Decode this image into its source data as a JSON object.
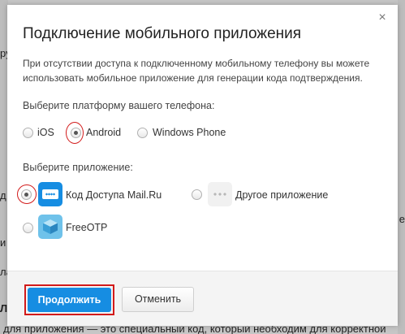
{
  "background": {
    "bottom_text": "для приложения — это специальный код, который необходим для корректной",
    "left_fragments": [
      "ру",
      "д",
      "и",
      "ла",
      "Л"
    ],
    "right_fragments": [
      "е"
    ]
  },
  "dialog": {
    "close_glyph": "×",
    "title": "Подключение мобильного приложения",
    "description": "При отсутствии доступа к подключенному мобильному телефону вы можете использовать мобильное приложение для генерации кода подтверждения.",
    "platform_label": "Выберите платформу вашего телефона:",
    "platforms": [
      {
        "label": "iOS",
        "checked": false
      },
      {
        "label": "Android",
        "checked": true
      },
      {
        "label": "Windows Phone",
        "checked": false
      }
    ],
    "app_label": "Выберите приложение:",
    "apps": [
      {
        "label": "Код Доступа Mail.Ru",
        "icon": "mailru-code-app-icon",
        "checked": true
      },
      {
        "label": "Другое приложение",
        "icon": "more-dots-icon",
        "checked": false
      },
      {
        "label": "FreeOTP",
        "icon": "freeotp-cube-icon",
        "checked": false
      }
    ],
    "continue_label": "Продолжить",
    "cancel_label": "Отменить"
  },
  "colors": {
    "primary": "#168de2",
    "highlight": "#d21a1a"
  }
}
